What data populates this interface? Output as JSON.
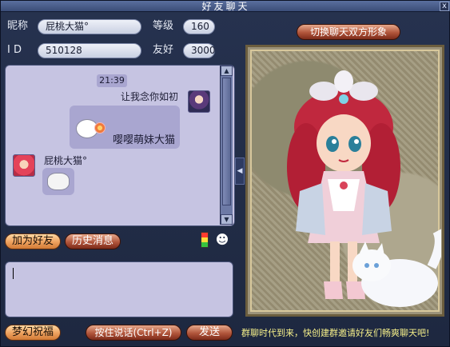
{
  "window": {
    "title": "好友聊天",
    "close_label": "x"
  },
  "info": {
    "nickname_label": "昵称",
    "nickname": "屁桃大猫°",
    "level_label": "等级",
    "level": "160",
    "id_label": "I D",
    "id": "510128",
    "friendship_label": "友好",
    "friendship": "3000"
  },
  "chat": {
    "timestamp": "21:39",
    "my_name": "让我念你如初",
    "my_message": "嘤嘤萌妹大猫",
    "other_name": "屁桃大猫°"
  },
  "buttons": {
    "add_friend": "加为好友",
    "history": "历史消息",
    "switch_avatar": "切换聊天双方形象",
    "blessing": "梦幻祝福",
    "hold_to_talk": "按住说话(Ctrl+Z)",
    "send": "发送"
  },
  "marquee_text": "群聊时代到来，快创建群邀请好友们畅爽聊天吧!",
  "icons": {
    "scroll_up": "up-arrow-icon",
    "scroll_down": "down-arrow-icon",
    "side_collapse": "left-arrow-icon",
    "signal": "signal-icon",
    "emoji": "emoji-icon"
  },
  "colors": {
    "window_bg": "#26324f",
    "chat_bg": "#c6c4e2",
    "button_orange": "#f0a563",
    "marquee_yellow": "#f6f08a"
  }
}
